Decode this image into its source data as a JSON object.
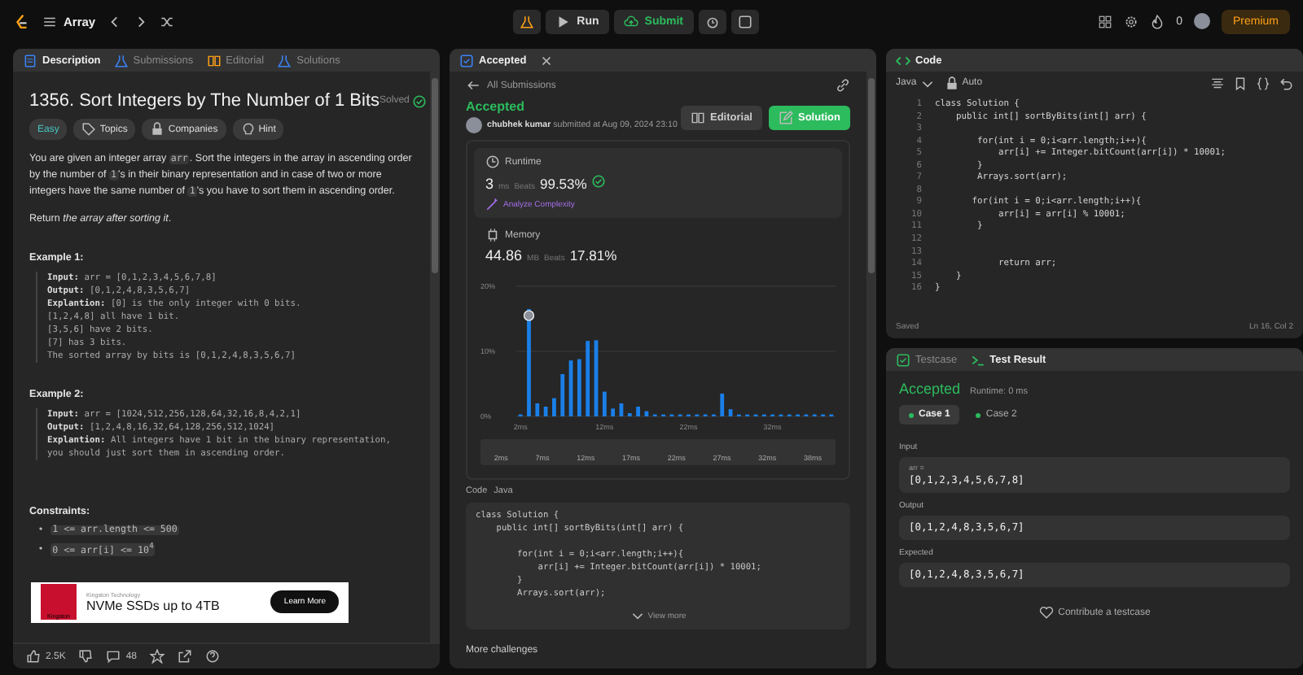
{
  "topbar": {
    "problem_list": "Array",
    "run": "Run",
    "submit": "Submit",
    "points": "0",
    "premium": "Premium"
  },
  "description_panel": {
    "tabs": [
      {
        "label": "Description",
        "selected": true
      },
      {
        "label": "Submissions",
        "selected": false
      },
      {
        "label": "Editorial",
        "selected": false
      },
      {
        "label": "Solutions",
        "selected": false
      }
    ],
    "title": "1356. Sort Integers by The Number of 1 Bits",
    "solved": "Solved",
    "tags": [
      {
        "kind": "difficulty",
        "label": "Easy"
      },
      {
        "kind": "topics",
        "label": "Topics"
      },
      {
        "kind": "companies",
        "label": "Companies"
      },
      {
        "kind": "hint",
        "label": "Hint"
      }
    ],
    "paragraphs": [
      [
        {
          "text": "You are given an integer array ",
          "code": false
        },
        {
          "text": "arr",
          "code": true
        },
        {
          "text": ". Sort the integers in the array in ascending order by the number of ",
          "code": false
        },
        {
          "text": "1",
          "code": true
        },
        {
          "text": "'s in their binary representation and in case of two or more integers have the same number of ",
          "code": false
        },
        {
          "text": "1",
          "code": true
        },
        {
          "text": "'s you have to sort them in ascending order.",
          "code": false
        }
      ],
      [
        {
          "text": "Return *the array after sorting it*.",
          "code": false
        }
      ]
    ],
    "examples": [
      {
        "title": "Example 1:",
        "lines": [
          "**Input:** arr = [0,1,2,3,4,5,6,7,8]",
          "**Output:** [0,1,2,4,8,3,5,6,7]",
          "**Explantion:** [0] is the only integer with 0 bits.",
          "[1,2,4,8] all have 1 bit.",
          "[3,5,6] have 2 bits.",
          "[7] has 3 bits.",
          "The sorted array by bits is [0,1,2,4,8,3,5,6,7]"
        ]
      },
      {
        "title": "Example 2:",
        "lines": [
          "**Input:** arr = [1024,512,256,128,64,32,16,8,4,2,1]",
          "**Output:** [1,2,4,8,16,32,64,128,256,512,1024]",
          "**Explantion:** All integers have 1 bit in the binary representation,",
          "you should just sort them in ascending order."
        ]
      }
    ],
    "constraints_title": "Constraints:",
    "constraints": [
      {
        "bullet": "•",
        "text": "1 <= arr.length <= 500"
      },
      {
        "bullet": "•",
        "text": "0 <= arr[i] <= 10$^{4}$"
      }
    ],
    "ad": {
      "logo": "Kingston",
      "sponsor": "Kingston Technology",
      "headline": "NVMe SSDs up to 4TB",
      "cta": "Learn More"
    },
    "likes": "2.5K",
    "comments": "48"
  },
  "submission_panel": {
    "tab": "Accepted",
    "back": "All Submissions",
    "status": "Accepted",
    "user": "chubhek kumar",
    "submitted": "submitted at Aug 09, 2024 23:10",
    "buttons": [
      {
        "kind": "editorial",
        "label": "Editorial"
      },
      {
        "kind": "solution",
        "label": "Solution"
      }
    ],
    "runtime": {
      "label": "Runtime",
      "value": "3",
      "unit": "ms",
      "beats_label": "Beats",
      "beats": "99.53%",
      "analyze": "Analyze Complexity"
    },
    "memory": {
      "label": "Memory",
      "value": "44.86",
      "unit": "MB",
      "beats_label": "Beats",
      "beats": "17.81%"
    },
    "chart_data": {
      "type": "bar",
      "x": [
        2,
        3,
        4,
        5,
        6,
        7,
        8,
        9,
        10,
        11,
        12,
        13,
        14,
        15,
        16,
        17,
        18,
        19,
        20,
        21,
        22,
        23,
        24,
        25,
        26,
        27,
        28,
        29,
        30,
        31,
        32,
        33,
        34,
        35,
        36,
        37,
        38,
        39
      ],
      "series": [
        {
          "color": "#1a7fe8",
          "values": [
            0.3,
            16.5,
            2,
            1.5,
            2.8,
            6.5,
            8.6,
            8.8,
            11.6,
            11.7,
            3.8,
            1.2,
            2,
            0.5,
            1.5,
            0.8,
            0.3,
            0.3,
            0.3,
            0.3,
            0.3,
            0.3,
            0.3,
            0.3,
            3.5,
            1.1,
            0.3,
            0.3,
            0.3,
            0.3,
            0.3,
            0.3,
            0.3,
            0.3,
            0.3,
            0.3,
            0.3,
            0.3
          ]
        }
      ],
      "xlim": [
        1.5,
        39.5
      ],
      "ylim": [
        0,
        20
      ],
      "yticks": [
        {
          "value": 0,
          "label": "0%"
        },
        {
          "value": 10,
          "label": "10%"
        },
        {
          "value": 20,
          "label": "20%"
        }
      ],
      "xticks": [
        {
          "value": 2,
          "label": "2ms"
        },
        {
          "value": 12,
          "label": "12ms"
        },
        {
          "value": 22,
          "label": "22ms"
        },
        {
          "value": 32,
          "label": "32ms"
        }
      ]
    },
    "range_labels": [
      "2ms",
      "7ms",
      "12ms",
      "17ms",
      "22ms",
      "27ms",
      "32ms",
      "38ms"
    ],
    "code_label": "Code",
    "language": "Java",
    "code": [
      {
        "kind": "code",
        "text": "class Solution {"
      },
      {
        "kind": "code",
        "text": "    public int[] sortByBits(int[] arr) {"
      },
      {
        "kind": "blank"
      },
      {
        "kind": "code",
        "text": "        for(int i = 0;i<arr.length;i++){"
      },
      {
        "kind": "code",
        "text": "            arr[i] += Integer.bitCount(arr[i]) * 10001;"
      },
      {
        "kind": "code",
        "text": "        }"
      },
      {
        "kind": "code",
        "text": "        Arrays.sort(arr);"
      }
    ],
    "view_more": "View more",
    "more": "More challenges"
  },
  "code_panel": {
    "tab": "Code",
    "language": "Java",
    "mode": "Auto",
    "lines": [
      {
        "number": "1",
        "text": "class Solution {"
      },
      {
        "number": "2",
        "text": "    public int[] sortByBits(int[] arr) {"
      },
      {
        "number": "3"
      },
      {
        "number": "4",
        "text": "        for(int i = 0;i<arr.length;i++){"
      },
      {
        "number": "5",
        "text": "            arr[i] += Integer.bitCount(arr[i]) * 10001;"
      },
      {
        "number": "6",
        "text": "        }"
      },
      {
        "number": "7",
        "text": "        Arrays.sort(arr);"
      },
      {
        "number": "8"
      },
      {
        "number": "9",
        "text": "       for(int i = 0;i<arr.length;i++){"
      },
      {
        "number": "10",
        "text": "            arr[i] = arr[i] % 10001;"
      },
      {
        "number": "11",
        "text": "        }"
      },
      {
        "number": "12"
      },
      {
        "number": "13"
      },
      {
        "number": "14",
        "text": "            return arr;"
      },
      {
        "number": "15",
        "text": "    }"
      },
      {
        "number": "16",
        "text": "}"
      }
    ],
    "saved": "Saved",
    "position": "Ln 16, Col 2"
  },
  "test_panel": {
    "tabs": [
      {
        "label": "Testcase",
        "selected": false
      },
      {
        "label": "Test Result",
        "selected": true
      }
    ],
    "status": "Accepted",
    "runtime": "Runtime: 0 ms",
    "cases": [
      {
        "label": "Case 1",
        "selected": true,
        "passed": true
      },
      {
        "label": "Case 2",
        "selected": false,
        "passed": true
      }
    ],
    "fields": [
      {
        "label": "Input",
        "name": "arr =",
        "value": "[0,1,2,3,4,5,6,7,8]"
      },
      {
        "label": "Output",
        "value": "[0,1,2,4,8,3,5,6,7]"
      },
      {
        "label": "Expected",
        "value": "[0,1,2,4,8,3,5,6,7]"
      }
    ],
    "contribute": "Contribute a testcase"
  }
}
